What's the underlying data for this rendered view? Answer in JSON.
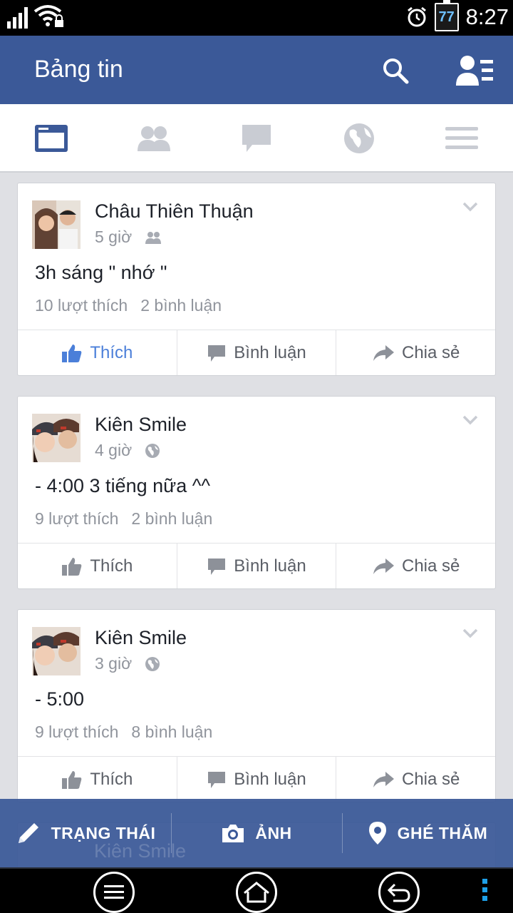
{
  "status_bar": {
    "battery_level": "77",
    "time": "8:27"
  },
  "app_bar": {
    "title": "Bảng tin"
  },
  "tabs": [
    {
      "icon": "news-feed-icon",
      "active": true
    },
    {
      "icon": "friends-icon",
      "active": false
    },
    {
      "icon": "messages-icon",
      "active": false
    },
    {
      "icon": "globe-icon",
      "active": false
    },
    {
      "icon": "menu-icon",
      "active": false
    }
  ],
  "posts": [
    {
      "author": "Châu Thiên Thuận",
      "time": "5 giờ",
      "privacy_icon": "friends-icon",
      "text": "3h sáng \" nhớ \"",
      "likes": "10 lượt thích",
      "comments": "2 bình luận",
      "liked": true
    },
    {
      "author": "Kiên Smile",
      "time": "4 giờ",
      "privacy_icon": "globe-icon",
      "text": "- 4:00 3 tiếng nữa ^^",
      "likes": "9 lượt thích",
      "comments": "2 bình luận",
      "liked": false
    },
    {
      "author": "Kiên Smile",
      "time": "3 giờ",
      "privacy_icon": "globe-icon",
      "text": "- 5:00",
      "likes": "9 lượt thích",
      "comments": "8 bình luận",
      "liked": false
    }
  ],
  "partial_post": {
    "author": "Kiên Smile"
  },
  "actions": {
    "like": "Thích",
    "comment": "Bình luận",
    "share": "Chia sẻ"
  },
  "publisher": {
    "status": "TRẠNG THÁI",
    "photo": "ẢNH",
    "checkin": "GHÉ THĂM"
  },
  "colors": {
    "brand": "#3b5998",
    "liked": "#4b7fd9",
    "muted": "#90949c"
  }
}
